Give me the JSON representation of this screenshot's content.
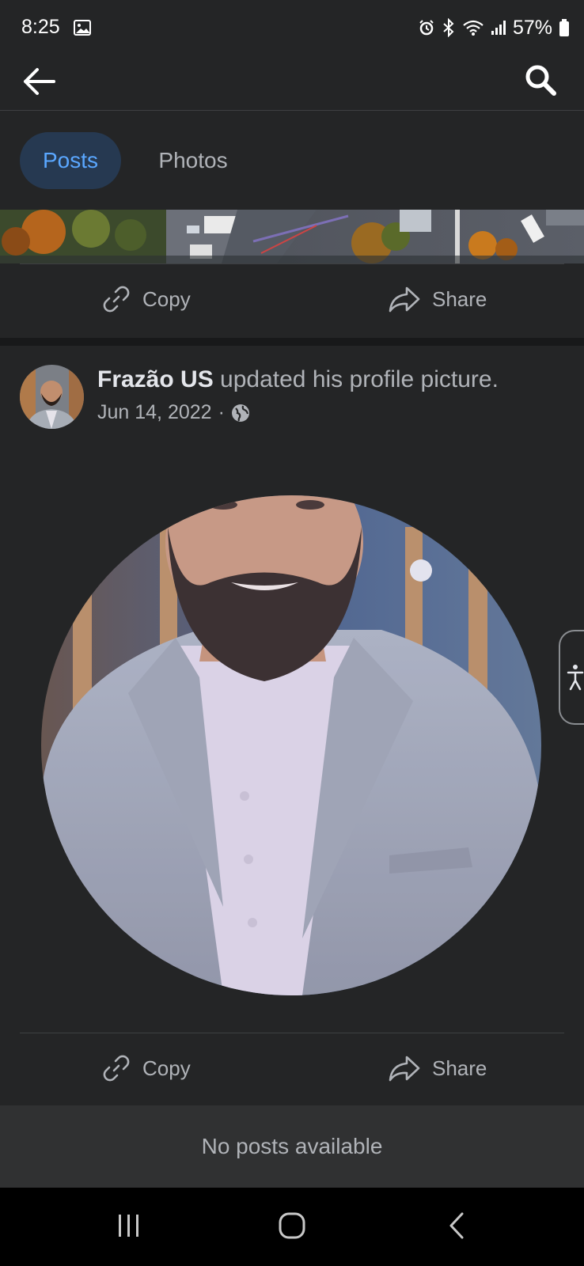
{
  "status_bar": {
    "time": "8:25",
    "battery": "57%",
    "icons": [
      "gallery-icon",
      "alarm-icon",
      "bluetooth-icon",
      "wifi-icon",
      "signal-icon",
      "battery-icon"
    ]
  },
  "app_bar": {
    "icons": [
      "back-arrow-icon",
      "search-icon"
    ]
  },
  "tabs": [
    {
      "label": "Posts",
      "active": true
    },
    {
      "label": "Photos",
      "active": false
    }
  ],
  "actions": {
    "copy_label": "Copy",
    "share_label": "Share"
  },
  "post": {
    "author": "Frazão US",
    "action_text": " updated his profile picture.",
    "date": "Jun 14, 2022",
    "separator": "·",
    "privacy_icon": "globe-icon"
  },
  "empty_state": "No posts available",
  "nav_bar": {
    "icons": [
      "recent-apps-icon",
      "home-icon",
      "back-icon"
    ]
  },
  "colors": {
    "background": "#242526",
    "accent": "#5aa7ff",
    "active_tab_bg": "#263951",
    "text_primary": "#e4e6eb",
    "text_secondary": "#b0b3b8"
  }
}
